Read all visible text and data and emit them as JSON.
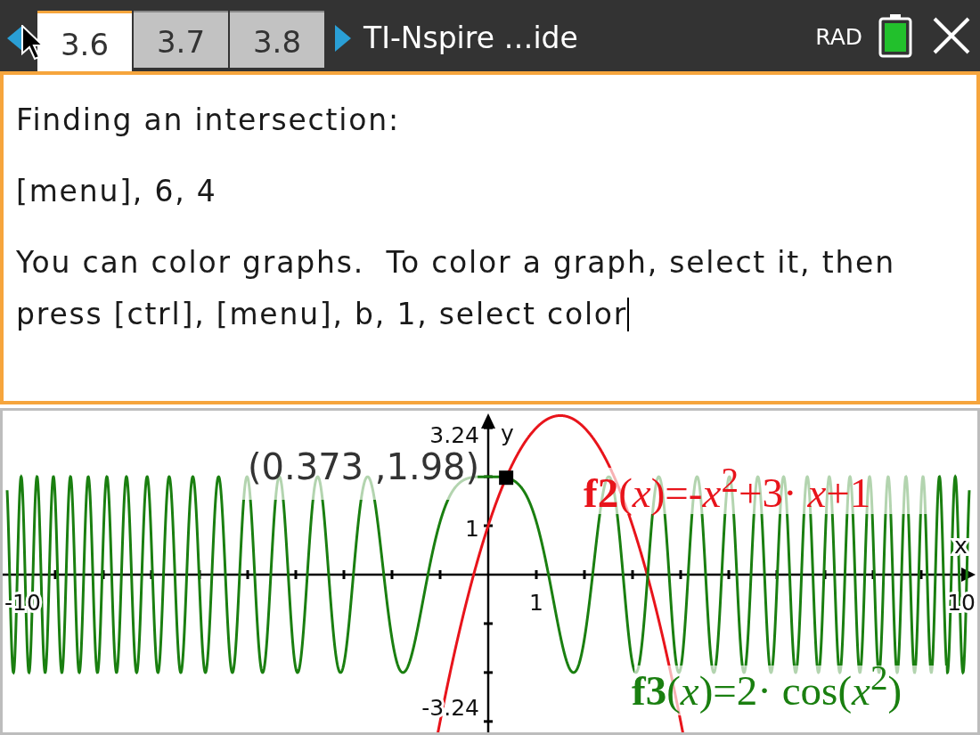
{
  "top_bar": {
    "tabs": [
      {
        "label": "3.6",
        "selected": true
      },
      {
        "label": "3.7",
        "selected": false
      },
      {
        "label": "3.8",
        "selected": false
      }
    ],
    "document_title": "TI-Nspire …ide",
    "angle_mode": "RAD"
  },
  "notes": {
    "paragraphs": [
      "Finding an intersection:",
      "[menu], 6, 4",
      "You can color graphs.  To color a graph, select it, then press [ctrl], [menu], b, 1, select color"
    ]
  },
  "graph": {
    "x_axis_label": "x",
    "y_axis_label": "y",
    "tick_labels": [
      {
        "kind": "y_max",
        "text": "3.24"
      },
      {
        "kind": "y_unit",
        "text": "1"
      },
      {
        "kind": "x_min",
        "text": "-10"
      },
      {
        "kind": "x_unit",
        "text": "1"
      },
      {
        "kind": "x_max",
        "text": "10"
      },
      {
        "kind": "y_min",
        "text": "-3.24"
      }
    ],
    "functions": [
      {
        "kind": "quadratic",
        "formula": "**f2**(*x*)=-*x*$^{2}$+3· *x*+1",
        "color": "#e8141b"
      },
      {
        "kind": "cosine",
        "formula": "**f3**(*x*)=2· cos(*x*$^{2}$)",
        "color": "#1a7f10"
      }
    ],
    "point": {
      "label": "(0.373 ,1.98)"
    }
  }
}
